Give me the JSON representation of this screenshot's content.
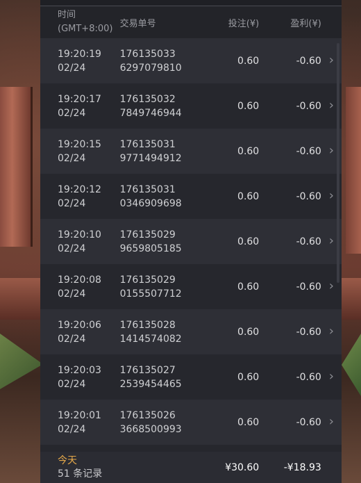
{
  "header": {
    "time_label": "时间",
    "timezone": "(GMT+8:00)",
    "order_label": "交易单号",
    "bet_label": "投注(¥)",
    "profit_label": "盈利(¥)"
  },
  "rows": [
    {
      "time": "19:20:19",
      "date": "02/24",
      "order_a": "176135033",
      "order_b": "6297079810",
      "bet": "0.60",
      "profit": "-0.60"
    },
    {
      "time": "19:20:17",
      "date": "02/24",
      "order_a": "176135032",
      "order_b": "7849746944",
      "bet": "0.60",
      "profit": "-0.60"
    },
    {
      "time": "19:20:15",
      "date": "02/24",
      "order_a": "176135031",
      "order_b": "9771494912",
      "bet": "0.60",
      "profit": "-0.60"
    },
    {
      "time": "19:20:12",
      "date": "02/24",
      "order_a": "176135031",
      "order_b": "0346909698",
      "bet": "0.60",
      "profit": "-0.60"
    },
    {
      "time": "19:20:10",
      "date": "02/24",
      "order_a": "176135029",
      "order_b": "9659805185",
      "bet": "0.60",
      "profit": "-0.60"
    },
    {
      "time": "19:20:08",
      "date": "02/24",
      "order_a": "176135029",
      "order_b": "0155507712",
      "bet": "0.60",
      "profit": "-0.60"
    },
    {
      "time": "19:20:06",
      "date": "02/24",
      "order_a": "176135028",
      "order_b": "1414574082",
      "bet": "0.60",
      "profit": "-0.60"
    },
    {
      "time": "19:20:03",
      "date": "02/24",
      "order_a": "176135027",
      "order_b": "2539454465",
      "bet": "0.60",
      "profit": "-0.60"
    },
    {
      "time": "19:20:01",
      "date": "02/24",
      "order_a": "176135026",
      "order_b": "3668500993",
      "bet": "0.60",
      "profit": "-0.60"
    }
  ],
  "row_chevron": "›",
  "row_icon": "chevron-right-icon",
  "footer": {
    "today_label": "今天",
    "count_label": "51 条记录",
    "total_bet": "¥30.60",
    "total_profit": "-¥18.93"
  },
  "colors": {
    "panel_bg": "#26272d",
    "row_alt_bg": "#2e2f36",
    "accent": "#e6a94a"
  }
}
